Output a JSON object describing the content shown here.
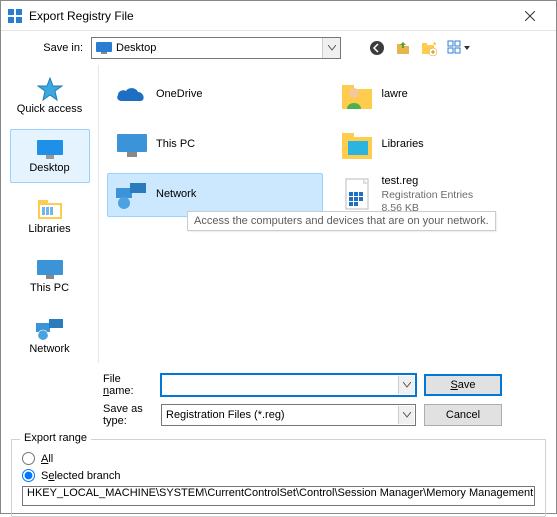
{
  "title": "Export Registry File",
  "savein": {
    "label": "Save in:",
    "value": "Desktop"
  },
  "sidebar": {
    "items": [
      {
        "label": "Quick access"
      },
      {
        "label": "Desktop"
      },
      {
        "label": "Libraries"
      },
      {
        "label": "This PC"
      },
      {
        "label": "Network"
      }
    ],
    "selectedIndex": 1
  },
  "files": {
    "items": [
      {
        "name": "OneDrive"
      },
      {
        "name": "lawre"
      },
      {
        "name": "This PC"
      },
      {
        "name": "Libraries"
      },
      {
        "name": "Network",
        "selected": true
      },
      {
        "name": "test.reg",
        "detail1": "Registration Entries",
        "detail2": "8.56 KB"
      }
    ],
    "tooltip": "Access the computers and devices that are on your network."
  },
  "form": {
    "filename_label": "File name:",
    "filename_value": "",
    "saveastype_label": "Save as type:",
    "saveastype_value": "Registration Files (*.reg)",
    "save_btn": "Save",
    "cancel_btn": "Cancel"
  },
  "export": {
    "legend": "Export range",
    "all_label": "All",
    "selected_label": "Selected branch",
    "branch_path": "HKEY_LOCAL_MACHINE\\SYSTEM\\CurrentControlSet\\Control\\Session Manager\\Memory Management"
  }
}
